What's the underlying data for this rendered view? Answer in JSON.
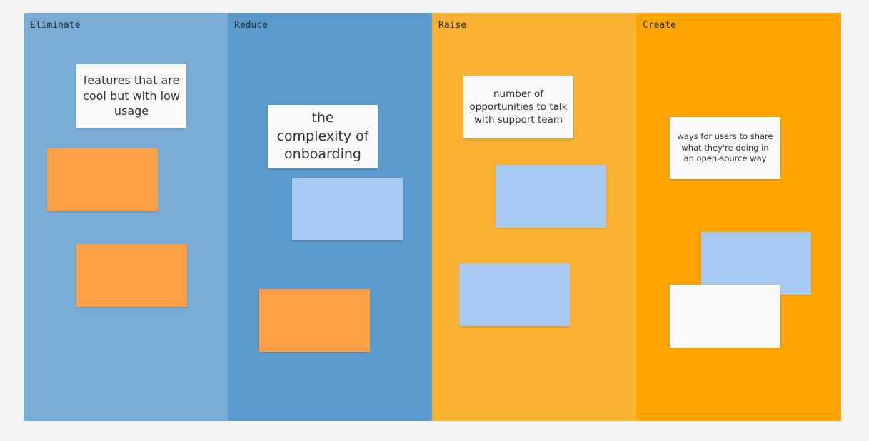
{
  "columns": [
    {
      "title": "Eliminate",
      "color": "#78acd4"
    },
    {
      "title": "Reduce",
      "color": "#5b9bcc"
    },
    {
      "title": "Raise",
      "color": "#fbb232"
    },
    {
      "title": "Create",
      "color": "#ffa500"
    }
  ],
  "notes": {
    "eliminate": "features that are cool but with low usage",
    "reduce": "the complexity of onboarding",
    "raise": "number of opportunities to talk with support team",
    "create": "ways for users to share what they're doing in an open-source way"
  },
  "note_colors": {
    "white": "#fafafa",
    "orange": "#ff9f47",
    "blue": "#a8cbf4"
  }
}
